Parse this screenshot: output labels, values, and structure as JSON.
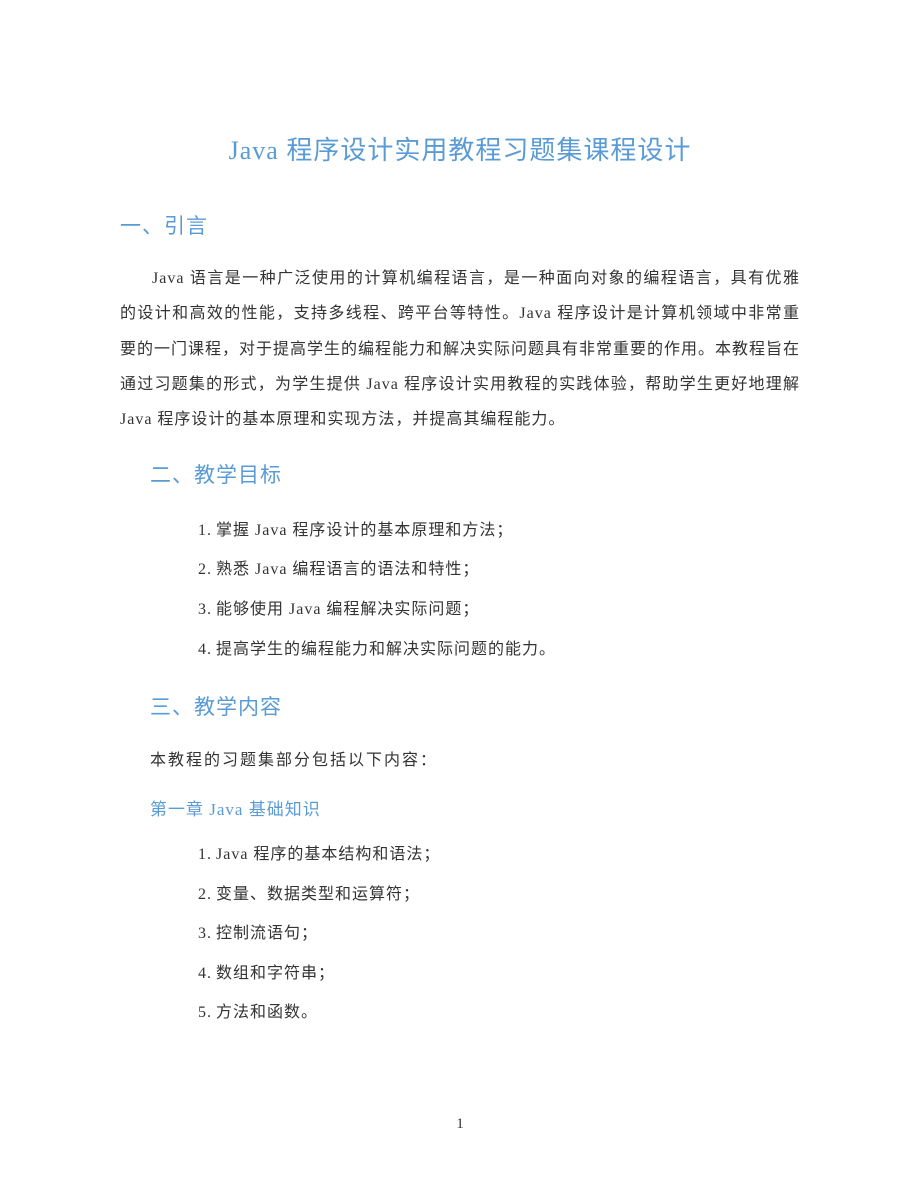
{
  "title": "Java 程序设计实用教程习题集课程设计",
  "sections": {
    "intro": {
      "heading": "一、引言",
      "paragraph": "Java 语言是一种广泛使用的计算机编程语言，是一种面向对象的编程语言，具有优雅的设计和高效的性能，支持多线程、跨平台等特性。Java 程序设计是计算机领域中非常重要的一门课程，对于提高学生的编程能力和解决实际问题具有非常重要的作用。本教程旨在通过习题集的形式，为学生提供 Java 程序设计实用教程的实践体验，帮助学生更好地理解 Java 程序设计的基本原理和实现方法，并提高其编程能力。"
    },
    "goals": {
      "heading": "二、教学目标",
      "items": [
        "掌握 Java 程序设计的基本原理和方法；",
        "熟悉 Java 编程语言的语法和特性；",
        "能够使用 Java 编程解决实际问题；",
        "提高学生的编程能力和解决实际问题的能力。"
      ]
    },
    "content": {
      "heading": "三、教学内容",
      "lead": "本教程的习题集部分包括以下内容：",
      "chapter1": {
        "heading": "第一章 Java 基础知识",
        "items": [
          "Java 程序的基本结构和语法；",
          "变量、数据类型和运算符；",
          "控制流语句；",
          "数组和字符串；",
          "方法和函数。"
        ]
      }
    }
  },
  "pageNumber": "1"
}
